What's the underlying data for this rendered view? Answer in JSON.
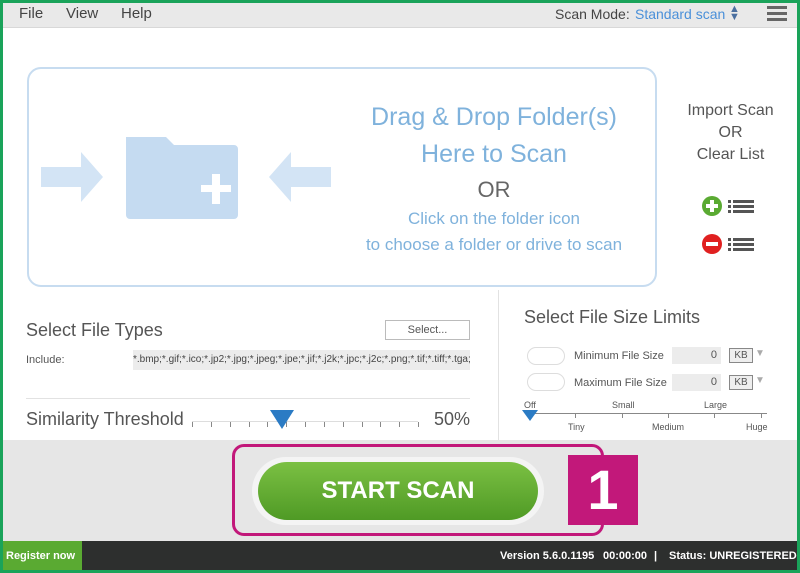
{
  "menu": {
    "file": "File",
    "view": "View",
    "help": "Help",
    "scan_mode_label": "Scan Mode:",
    "scan_mode_value": "Standard scan"
  },
  "drop": {
    "line1": "Drag & Drop Folder(s)",
    "line2": "Here to Scan",
    "or": "OR",
    "line3": "Click on the folder icon",
    "line4": "to choose a folder or drive to scan"
  },
  "import": {
    "line1": "Import Scan",
    "or": "OR",
    "line2": "Clear List"
  },
  "file_types": {
    "title": "Select File Types",
    "select_label": "Select...",
    "include_label": "Include:",
    "include_value": "*.bmp;*.gif;*.ico;*.jp2;*.jpg;*.jpeg;*.jpe;*.jif;*.j2k;*.jpc;*.j2c;*.png;*.tif;*.tiff;*.tga;*.w"
  },
  "similarity": {
    "label": "Similarity Threshold",
    "value": "50%",
    "percent": 50
  },
  "size_limits": {
    "title": "Select File Size Limits",
    "min_label": "Minimum File Size",
    "min_value": "0",
    "min_unit": "KB",
    "max_label": "Maximum File Size",
    "max_value": "0",
    "max_unit": "KB",
    "scale_top": [
      "Off",
      "Small",
      "Large"
    ],
    "scale_bottom": [
      "Tiny",
      "Medium",
      "Huge"
    ],
    "selected": "Off"
  },
  "start_scan": "START SCAN",
  "callout": "1",
  "status": {
    "register": "Register now",
    "version": "Version 5.6.0.1195",
    "time": "00:00:00",
    "sep": "|",
    "status": "Status: UNREGISTERED"
  },
  "colors": {
    "accent": "#4a90d9",
    "green": "#5aaa32",
    "magenta": "#c2187a",
    "statusbar": "#2d2f2e"
  }
}
